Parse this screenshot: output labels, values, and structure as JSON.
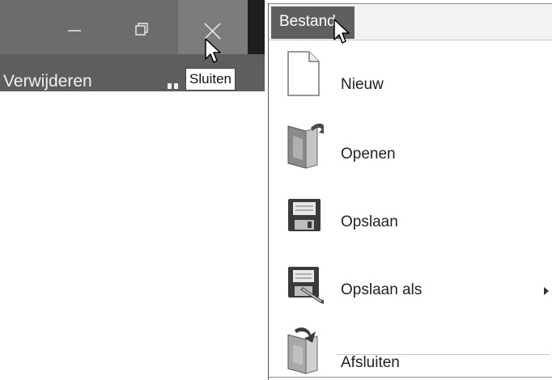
{
  "window": {
    "controls": {
      "minimize_icon": "minimize-icon",
      "maximize_icon": "restore-icon",
      "close_icon": "close-icon"
    },
    "ribbon_text": "Verwijderen",
    "tooltip": "Sluiten"
  },
  "menu": {
    "tab_label": "Bestand",
    "items": [
      {
        "label": "Nieuw",
        "icon": "new-document-icon",
        "has_submenu": false
      },
      {
        "label": "Openen",
        "icon": "open-folder-icon",
        "has_submenu": false
      },
      {
        "label": "Opslaan",
        "icon": "save-icon",
        "has_submenu": false
      },
      {
        "label": "Opslaan als",
        "icon": "save-as-icon",
        "has_submenu": true
      },
      {
        "label": "Afsluiten",
        "icon": "exit-icon",
        "has_submenu": false
      }
    ]
  },
  "colors": {
    "titlebar": "#6c6c6c",
    "close_hover": "#7c7c7c",
    "ribbon": "#5e5e5e",
    "menu_tab_active": "#5f5f5f",
    "menubar": "#f2f2f2"
  }
}
